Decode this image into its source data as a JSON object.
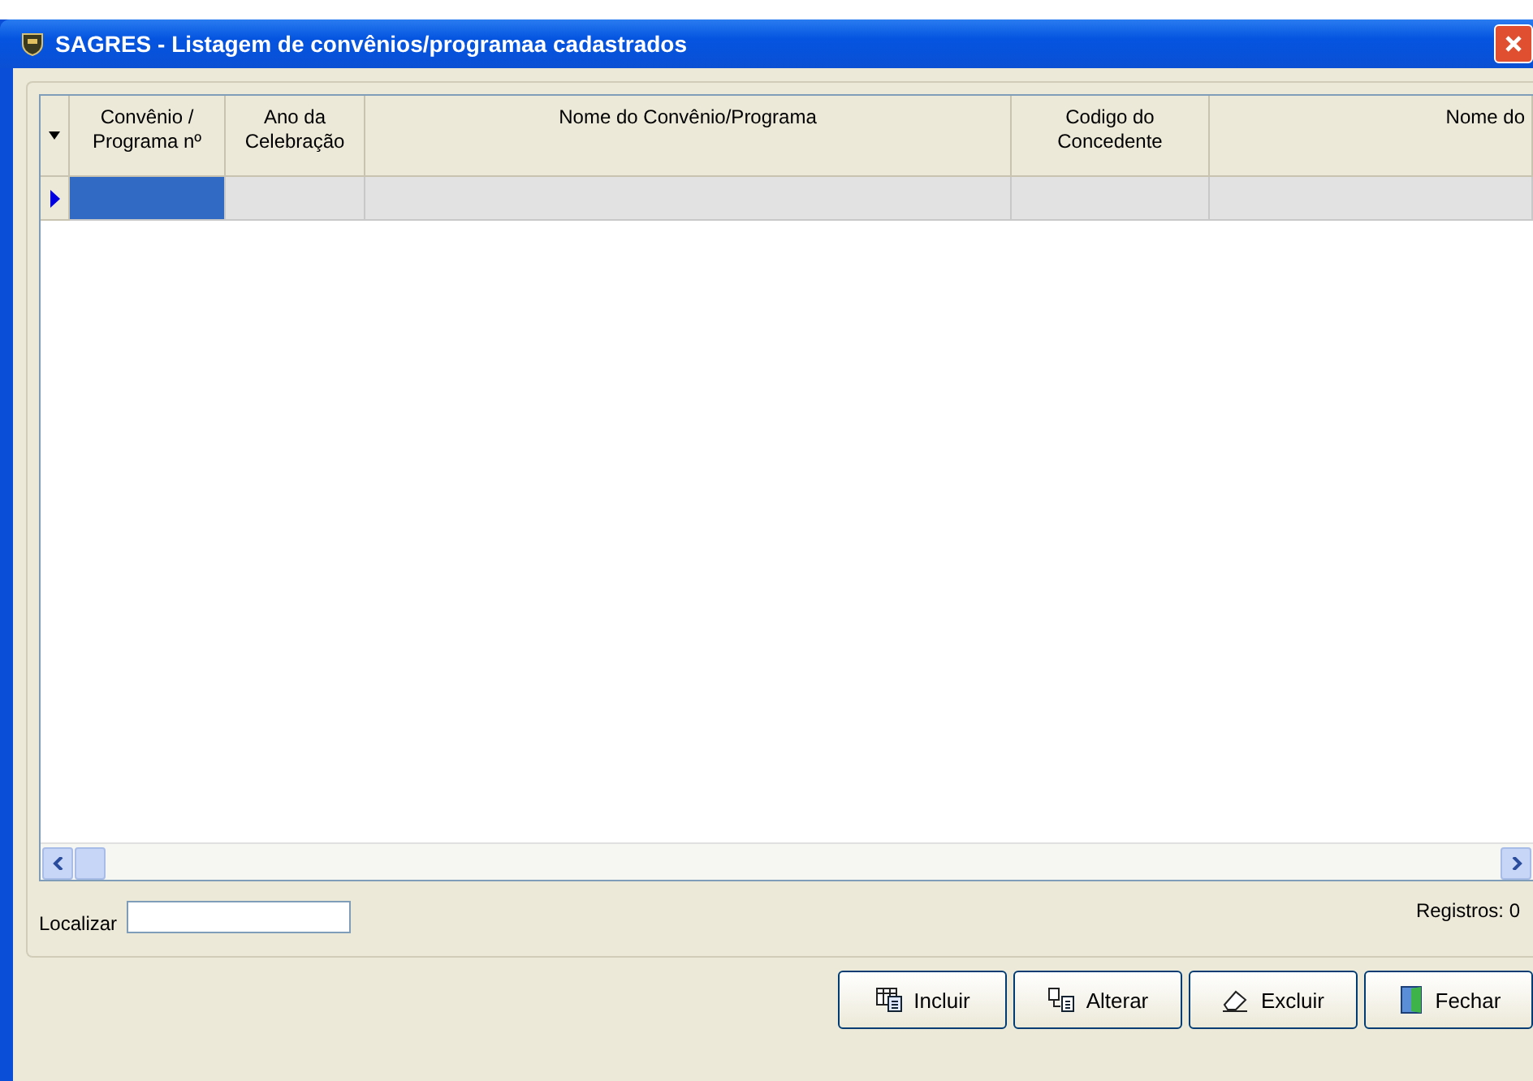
{
  "window": {
    "title": "SAGRES - Listagem de convênios/programaa cadastrados"
  },
  "table": {
    "columns": [
      {
        "label": "Convênio / Programa nº"
      },
      {
        "label": "Ano da Celebração"
      },
      {
        "label": "Nome do Convênio/Programa"
      },
      {
        "label": "Codigo do Concedente"
      },
      {
        "label": "Nome do"
      }
    ],
    "rows": [
      {
        "selected": true
      }
    ]
  },
  "search": {
    "label": "Localizar"
  },
  "record_count": "Registros: 0",
  "buttons": [
    {
      "label": "Incluir",
      "kind": "add"
    },
    {
      "label": "Alterar",
      "kind": "edit"
    },
    {
      "label": "Excluir",
      "kind": "delete"
    },
    {
      "label": "Fechar",
      "kind": "close"
    }
  ]
}
